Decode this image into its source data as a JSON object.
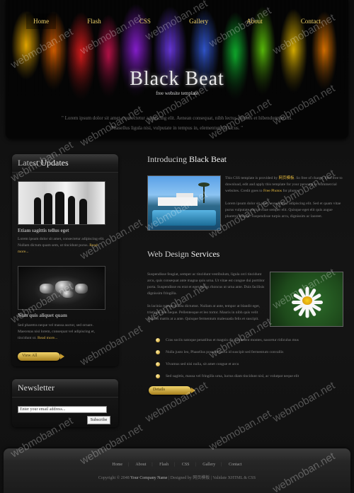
{
  "nav": {
    "items": [
      "Home",
      "Flash",
      "CSS",
      "Gallery",
      "About",
      "Contact"
    ],
    "active": "Home"
  },
  "header": {
    "title": "Black Beat",
    "subtitle": "free website template",
    "intro_line1": "\" Lorem ipsum dolor sit amet, consectetur adipiscing elit. Aenean consequat, nibh lectus ultrices et hibendum lectus.",
    "intro_line2": "Phasellus ligula nisi, vulputate in tempus in, elementum id lacus. \""
  },
  "sidebar": {
    "updates_light": "Latest ",
    "updates_bold": "Updates",
    "post1_title": "Etiam sagittis tellus eget",
    "post1_text": "Lorem ipsum dolor sit amet, consectetur adipiscing elit. Nullam dictum quam sem, ut tincidunt purus.",
    "post1_more": "Read more...",
    "post2_title": "Nam quis aliquet quam",
    "post2_text": "Sed pharetra neque vel massa auctor, sed ornare. Maecenas nisi lorem, consequat vel adipiscing et, tincidunt ut.",
    "post2_more": "Read more...",
    "view_all": "View All",
    "newsletter_title": "Newsletter",
    "email_placeholder": "Enter your email address...",
    "subscribe": "Subscribe"
  },
  "main": {
    "intro_light": "Introducing ",
    "intro_bold": "Black Beat",
    "p1_a": "This CSS template is provided by ",
    "p1_link": "网页模板",
    "p1_b": ". So free of charge. Feel free to download, edit and apply this template for your personal or commercial websites. Credit goes to ",
    "p1_credit": "Free Photos",
    "p1_c": " for photos.",
    "p1_d": "Lorem ipsum dolor sit amet, consectetur adipiscing elit. Sed et quam vitae purus vulputate varius vitae semper elit. Quisque eget elit quis augue pharetra feugiat. Suspendisse turpis arcu, dignissim ac laoreet.",
    "services_light": "Web Design ",
    "services_bold": "Services",
    "p2": "Suspendisse feugiat, semper ac tincidunt vestibulum, ligula orci tincidunt arcu, quis consequat ante magna quis urna. Ut vitae est congue dui porttitor porta. Suspendisse eu erat et eget luctus rhoncus ut urna ante. Duis facilisis dignissim fringilla.",
    "p3": "In lacinia rutrum platea dictumst. Nullam at ante, tempor at blandit eget, tristique non neque. Pellentesque et leo tortor. Mauris in nibh quis velit sodales mattis at a ante. Quisque fermentum malesuada felis et suscipit.",
    "bullets": [
      "Cras sociis natoque penatibus et magnis dis parturient montes, nascetur ridiculus mus",
      "Nulla justo leo, Phasellus posuere porta id suscipit sed fermentum convallis",
      "Vivamus sed nisi nulla, sit amet congue et arcu",
      "Sed sagittis, massa vel fringilla urna, luctus diam tincidunt nisl, ac volutpat neque elit"
    ],
    "details": "Details"
  },
  "footer": {
    "links": [
      "Home",
      "About",
      "Flash",
      "CSS",
      "Gallery",
      "Contact"
    ],
    "copy_a": "Copyright © 2048 ",
    "company": "Your Company Name",
    "copy_b": " | Designed by 网页模板 | Validate XHTML & CSS"
  },
  "watermark": "webmoban.net",
  "colors": {
    "accent": "#f0d36a",
    "link": "#e4b93f",
    "bg": "#0b0b0b"
  }
}
